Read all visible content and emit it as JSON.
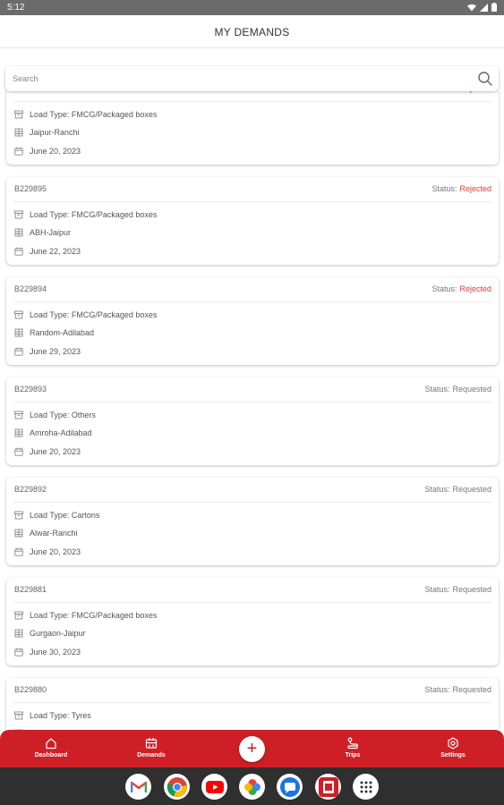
{
  "status_bar": {
    "time": "5:12"
  },
  "header": {
    "title": "MY DEMANDS"
  },
  "search": {
    "placeholder": "Search"
  },
  "demands": [
    {
      "id": "",
      "status_label": "Status:",
      "status": "Rejected",
      "status_color": "#e53935",
      "load_type": "Load Type: FMCG/Packaged boxes",
      "route": "Jaipur-Ranchi",
      "date": "June 20, 2023"
    },
    {
      "id": "B229895",
      "status_label": "Status:",
      "status": "Rejected",
      "status_color": "#e53935",
      "load_type": "Load Type: FMCG/Packaged boxes",
      "route": "ABH-Jaipur",
      "date": "June 22, 2023"
    },
    {
      "id": "B229894",
      "status_label": "Status:",
      "status": "Rejected",
      "status_color": "#e53935",
      "load_type": "Load Type: FMCG/Packaged boxes",
      "route": "Random-Adilabad",
      "date": "June 29, 2023"
    },
    {
      "id": "B229893",
      "status_label": "Status:",
      "status": "Requested",
      "status_color": "#777777",
      "load_type": "Load Type: Others",
      "route": "Amroha-Adilabad",
      "date": "June 20, 2023"
    },
    {
      "id": "B229892",
      "status_label": "Status:",
      "status": "Requested",
      "status_color": "#777777",
      "load_type": "Load Type: Cartons",
      "route": "Alwar-Ranchi",
      "date": "June 20, 2023"
    },
    {
      "id": "B229881",
      "status_label": "Status:",
      "status": "Requested",
      "status_color": "#777777",
      "load_type": "Load Type: FMCG/Packaged boxes",
      "route": "Gurgaon-Jaipur",
      "date": "June 30, 2023"
    },
    {
      "id": "B229880",
      "status_label": "Status:",
      "status": "Requested",
      "status_color": "#777777",
      "load_type": "Load Type: Tyres",
      "route": "",
      "date": ""
    }
  ],
  "bottom_nav": {
    "items": [
      {
        "label": "Dashboard",
        "icon": "home-icon"
      },
      {
        "label": "Demands",
        "icon": "demands-icon"
      },
      {
        "label": "Trips",
        "icon": "trips-icon"
      },
      {
        "label": "Settings",
        "icon": "settings-icon"
      }
    ],
    "fab_icon": "+",
    "color": "#cf1f26"
  },
  "dock_apps": [
    "gmail-icon",
    "chrome-icon",
    "youtube-icon",
    "photos-icon",
    "messages-icon",
    "app-icon",
    "app-drawer-icon"
  ]
}
